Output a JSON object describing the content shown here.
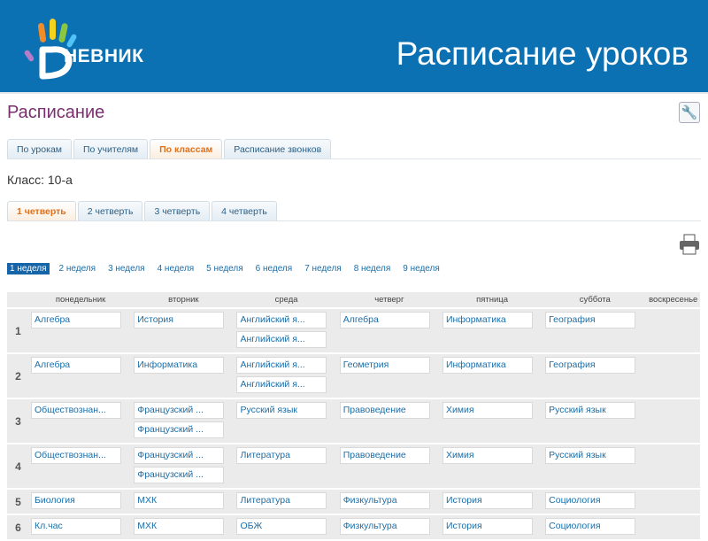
{
  "header": {
    "logo_text": "НЕВНИК",
    "title": "Расписание уроков"
  },
  "page_title": "Расписание",
  "view_tabs": [
    {
      "label": "По урокам"
    },
    {
      "label": "По учителям"
    },
    {
      "label": "По классам",
      "active": true
    },
    {
      "label": "Расписание звонков"
    }
  ],
  "class_label": "Класс: 10-а",
  "quarter_tabs": [
    {
      "label": "1 четверть",
      "active": true
    },
    {
      "label": "2 четверть"
    },
    {
      "label": "3 четверть"
    },
    {
      "label": "4 четверть"
    }
  ],
  "weeks": [
    {
      "label": "1 неделя",
      "active": true
    },
    {
      "label": "2 неделя"
    },
    {
      "label": "3 неделя"
    },
    {
      "label": "4 неделя"
    },
    {
      "label": "5 неделя"
    },
    {
      "label": "6 неделя"
    },
    {
      "label": "7 неделя"
    },
    {
      "label": "8 неделя"
    },
    {
      "label": "9 неделя"
    }
  ],
  "days": [
    "понедельник",
    "вторник",
    "среда",
    "четверг",
    "пятница",
    "суббота",
    "воскресенье"
  ],
  "rows": [
    {
      "num": "1",
      "cells": [
        [
          "Алгебра"
        ],
        [
          "История"
        ],
        [
          "Английский я...",
          "Английский я..."
        ],
        [
          "Алгебра"
        ],
        [
          "Информатика"
        ],
        [
          "География"
        ],
        []
      ]
    },
    {
      "num": "2",
      "cells": [
        [
          "Алгебра"
        ],
        [
          "Информатика"
        ],
        [
          "Английский я...",
          "Английский я..."
        ],
        [
          "Геометрия"
        ],
        [
          "Информатика"
        ],
        [
          "География"
        ],
        []
      ]
    },
    {
      "num": "3",
      "cells": [
        [
          "Обществознан..."
        ],
        [
          "Французский ...",
          "Французский ..."
        ],
        [
          "Русский язык"
        ],
        [
          "Правоведение"
        ],
        [
          "Химия"
        ],
        [
          "Русский язык"
        ],
        []
      ]
    },
    {
      "num": "4",
      "cells": [
        [
          "Обществознан..."
        ],
        [
          "Французский ...",
          "Французский ..."
        ],
        [
          "Литература"
        ],
        [
          "Правоведение"
        ],
        [
          "Химия"
        ],
        [
          "Русский язык"
        ],
        []
      ]
    },
    {
      "num": "5",
      "cells": [
        [
          "Биология"
        ],
        [
          "МХК"
        ],
        [
          "Литература"
        ],
        [
          "Физкультура"
        ],
        [
          "История"
        ],
        [
          "Социология"
        ],
        []
      ]
    },
    {
      "num": "6",
      "cells": [
        [
          "Кл.час"
        ],
        [
          "МХК"
        ],
        [
          "ОБЖ"
        ],
        [
          "Физкультура"
        ],
        [
          "История"
        ],
        [
          "Социология"
        ],
        []
      ]
    }
  ]
}
